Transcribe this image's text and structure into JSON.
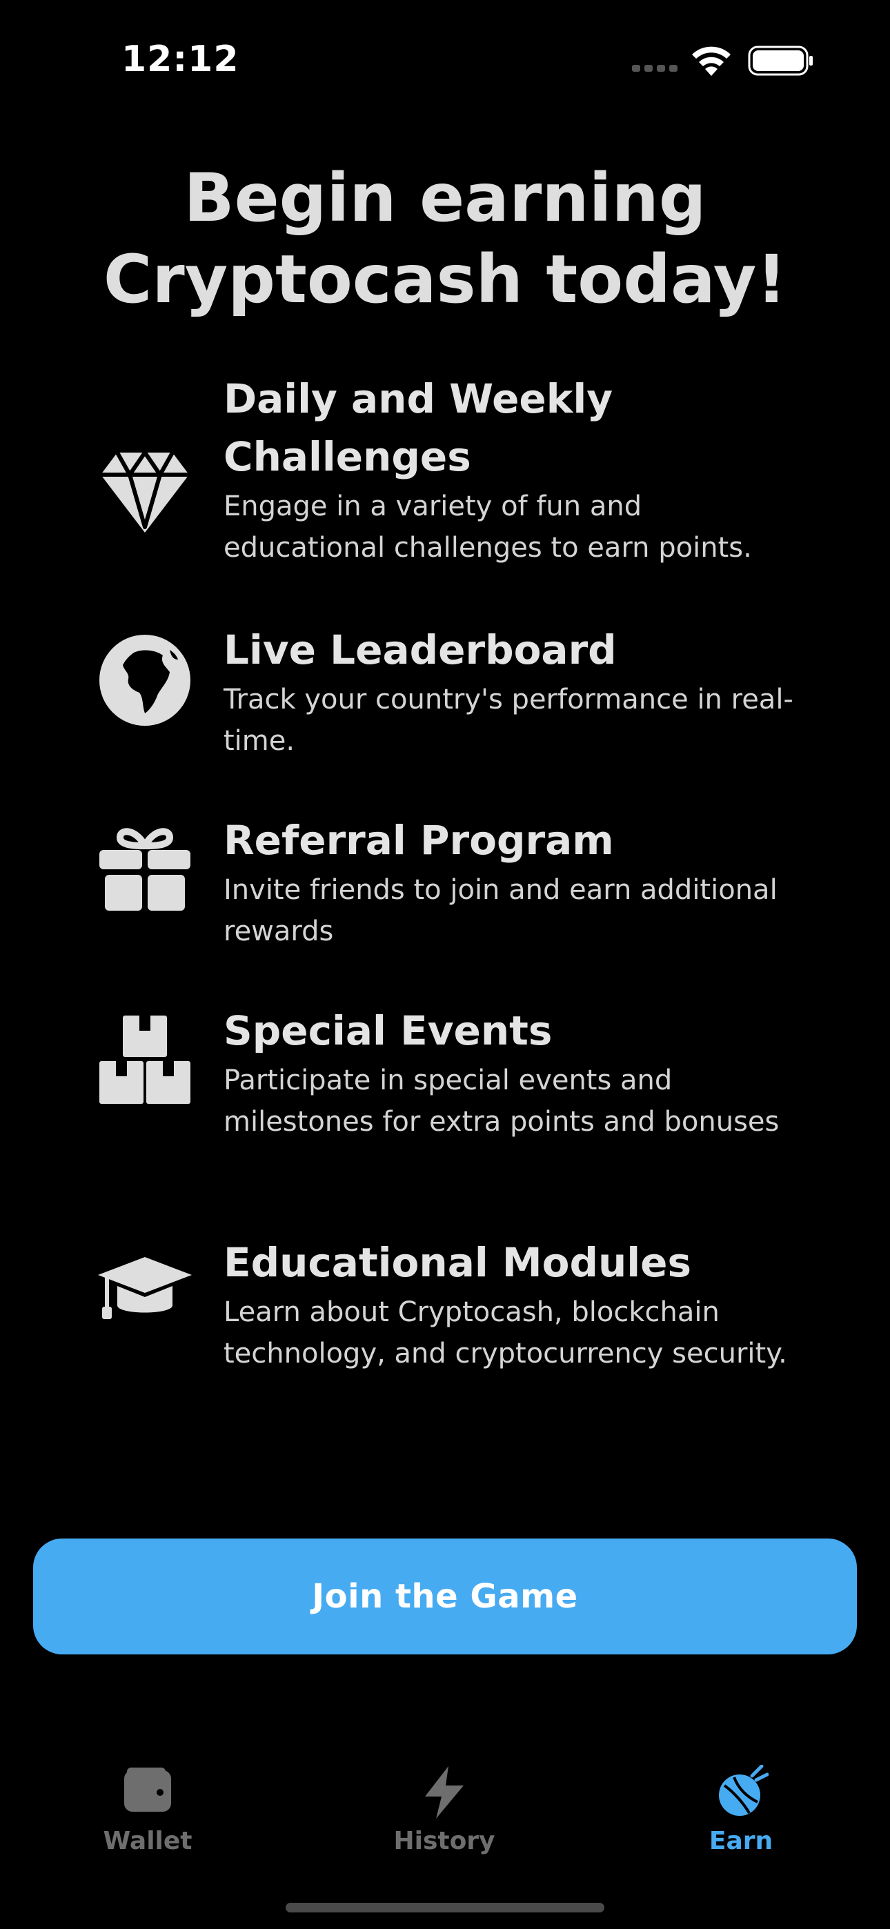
{
  "status_bar": {
    "time": "12:12"
  },
  "headline": {
    "line1": "Begin earning",
    "line2": "Cryptocash today!"
  },
  "features": [
    {
      "icon": "diamond-icon",
      "title": "Daily and Weekly Challenges",
      "description": "Engage in a variety of fun and educational challenges to earn points."
    },
    {
      "icon": "globe-icon",
      "title": "Live Leaderboard",
      "description": "Track your country's performance in real-time."
    },
    {
      "icon": "gift-icon",
      "title": "Referral Program",
      "description": "Invite friends to join and earn additional rewards"
    },
    {
      "icon": "boxes-icon",
      "title": "Special Events",
      "description": "Participate in special events and milestones for extra points and bonuses"
    },
    {
      "icon": "graduation-cap-icon",
      "title": "Educational Modules",
      "description": "Learn about Cryptocash, blockchain technology, and cryptocurrency security."
    }
  ],
  "cta": {
    "label": "Join the Game"
  },
  "tab_bar": {
    "tabs": [
      {
        "label": "Wallet",
        "icon": "wallet-icon",
        "active": false
      },
      {
        "label": "History",
        "icon": "lightning-icon",
        "active": false
      },
      {
        "label": "Earn",
        "icon": "rocket-icon",
        "active": true
      }
    ]
  },
  "colors": {
    "background": "#000000",
    "accent": "#47abf2",
    "text": "#e4e4e4",
    "inactive_tab": "#6e6e6e"
  }
}
